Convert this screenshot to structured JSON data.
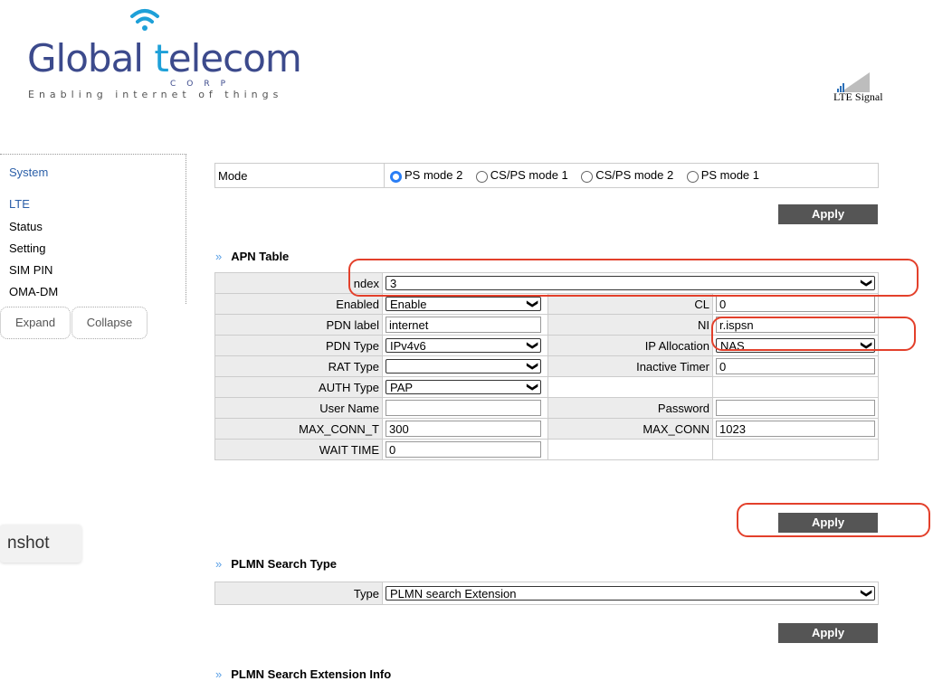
{
  "logo": {
    "text_pre": "Global ",
    "text_t": "t",
    "text_post": "elecom",
    "corp": "CORP",
    "tagline": "Enabling internet of things",
    "icon": "wifi-icon"
  },
  "signal": {
    "label": "LTE Signal",
    "icon": "signal-bars-icon"
  },
  "sidebar": {
    "system": "System",
    "lte": "LTE",
    "items": [
      "Status",
      "Setting",
      "SIM PIN",
      "OMA-DM"
    ],
    "expand": "Expand",
    "collapse": "Collapse"
  },
  "overlay": {
    "snapshot": "nshot"
  },
  "mode": {
    "label": "Mode",
    "options": [
      "PS mode 2",
      "CS/PS mode 1",
      "CS/PS mode 2",
      "PS mode 1"
    ],
    "selected": "PS mode 2",
    "apply": "Apply"
  },
  "apn": {
    "title": "APN Table",
    "index_label": "ndex",
    "index_value": "3",
    "enabled_label": "Enabled",
    "enabled_value": "Enable",
    "cl_label": "CL",
    "cl_value": "0",
    "pdn_label_label": "PDN label",
    "pdn_label_value": "internet",
    "ni_label": "NI",
    "ni_value": "r.ispsn",
    "pdn_type_label": "PDN Type",
    "pdn_type_value": "IPv4v6",
    "ip_alloc_label": "IP Allocation",
    "ip_alloc_value": "NAS",
    "rat_type_label": "RAT Type",
    "rat_type_value": "",
    "inactive_label": "Inactive Timer",
    "inactive_value": "0",
    "auth_label": "AUTH Type",
    "auth_value": "PAP",
    "user_label": "User Name",
    "user_value": "",
    "password_label": "Password",
    "password_value": "",
    "max_conn_t_label": "MAX_CONN_T",
    "max_conn_t_value": "300",
    "max_conn_label": "MAX_CONN",
    "max_conn_value": "1023",
    "wait_label": "WAIT TIME",
    "wait_value": "0",
    "apply": "Apply"
  },
  "plmn": {
    "title": "PLMN Search Type",
    "type_label": "Type",
    "type_value": "PLMN search Extension",
    "apply": "Apply"
  },
  "plmn_ext": {
    "title": "PLMN Search Extension Info"
  },
  "colors": {
    "highlight": "#e3402b",
    "apply_bg": "#555555",
    "accent": "#2a7ef5"
  }
}
